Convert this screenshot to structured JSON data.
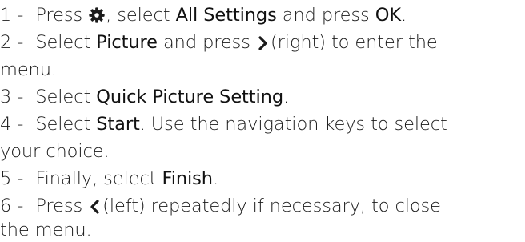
{
  "steps": [
    {
      "num": "1 -",
      "t1": "Press",
      "t2": ", select",
      "ui1": "All Settings",
      "t3": "and press",
      "ui2": "OK",
      "t4": "."
    },
    {
      "num": "2 -",
      "t1": "Select",
      "ui1": "Picture",
      "t2": "and press",
      "t3": "(right) to enter the"
    },
    {
      "cont": "menu."
    },
    {
      "num": "3 -",
      "t1": "Select",
      "ui1": "Quick Picture Setting",
      "t2": "."
    },
    {
      "num": "4 -",
      "t1": "Select",
      "ui1": "Start",
      "t2": ". Use the navigation keys to select"
    },
    {
      "cont": "your choice."
    },
    {
      "num": "5 -",
      "t1": "Finally, select",
      "ui1": "Finish",
      "t2": "."
    },
    {
      "num": "6 -",
      "t1": "Press",
      "t2": "(left) repeatedly if necessary, to close"
    },
    {
      "cont": "the menu."
    }
  ],
  "icons": {
    "step1": "settings-gear-icon",
    "step2": "chevron-right-icon",
    "step6": "chevron-left-icon"
  }
}
